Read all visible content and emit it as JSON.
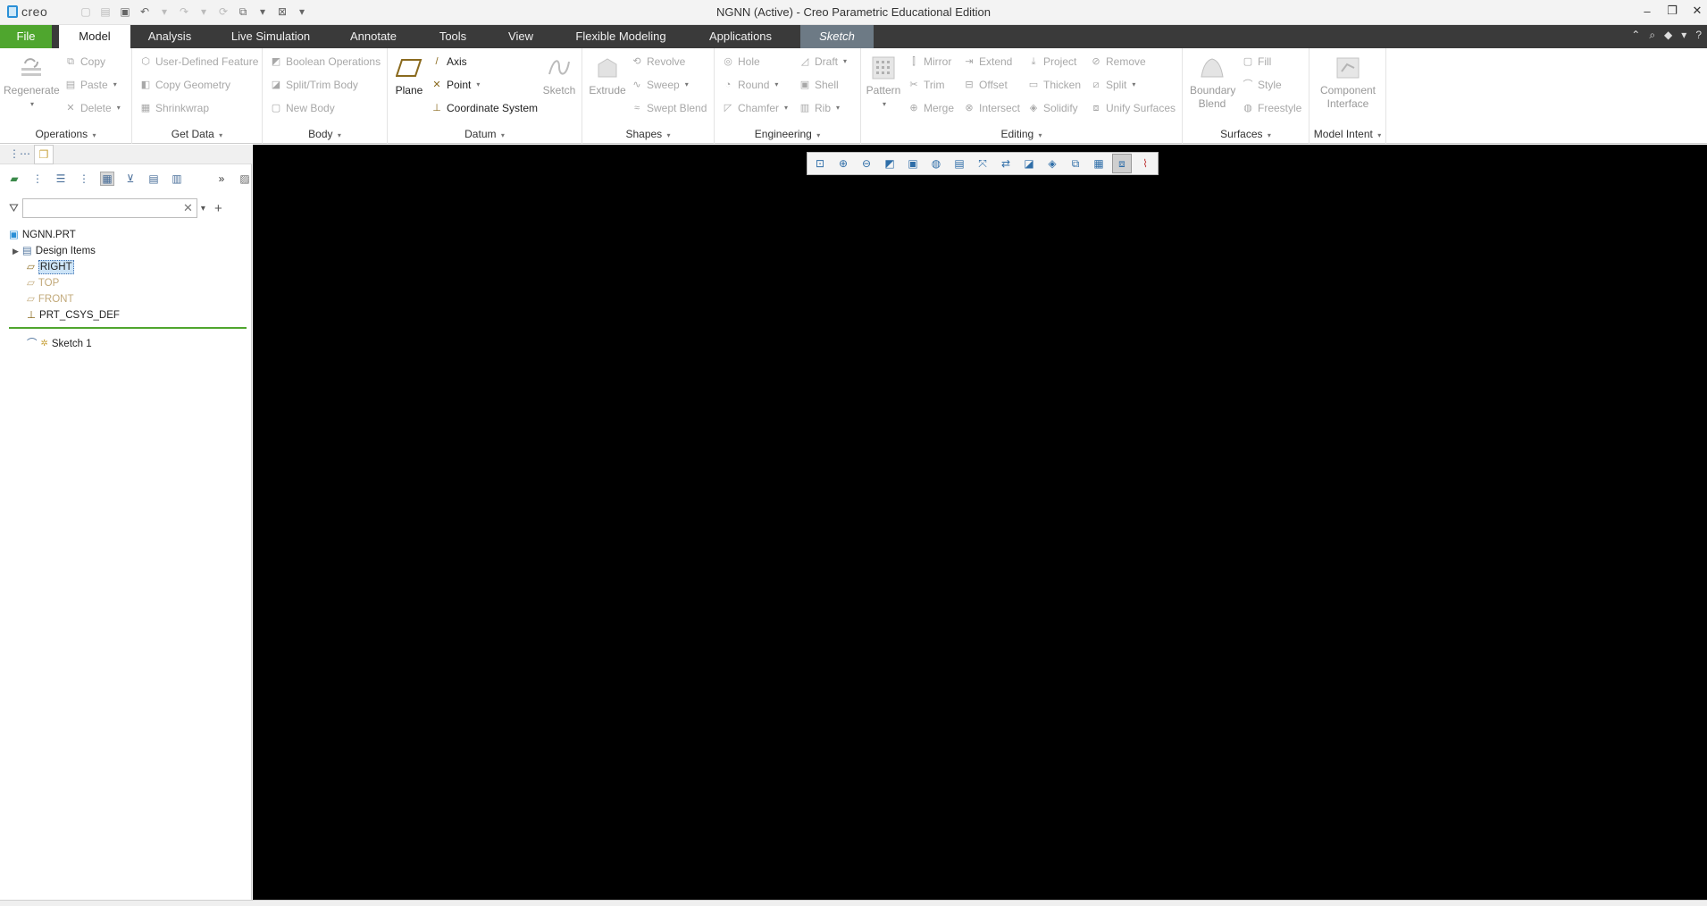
{
  "app": {
    "logo_text": "creo",
    "window_title": "NGNN (Active) - Creo Parametric Educational Edition"
  },
  "tabs": [
    {
      "label": "File"
    },
    {
      "label": "Model"
    },
    {
      "label": "Analysis"
    },
    {
      "label": "Live Simulation"
    },
    {
      "label": "Annotate"
    },
    {
      "label": "Tools"
    },
    {
      "label": "View"
    },
    {
      "label": "Flexible Modeling"
    },
    {
      "label": "Applications"
    },
    {
      "label": "Sketch"
    }
  ],
  "ribbon": {
    "operations": {
      "label": "Operations",
      "regenerate": "Regenerate",
      "copy": "Copy",
      "paste": "Paste",
      "delete": "Delete"
    },
    "get_data": {
      "label": "Get Data",
      "udf": "User-Defined Feature",
      "copy_geometry": "Copy Geometry",
      "shrinkwrap": "Shrinkwrap"
    },
    "body": {
      "label": "Body",
      "boolean": "Boolean Operations",
      "split_trim": "Split/Trim Body",
      "new_body": "New Body"
    },
    "datum": {
      "label": "Datum",
      "plane": "Plane",
      "axis": "Axis",
      "point": "Point",
      "csys": "Coordinate System",
      "sketch": "Sketch"
    },
    "shapes": {
      "label": "Shapes",
      "extrude": "Extrude",
      "revolve": "Revolve",
      "sweep": "Sweep",
      "swept_blend": "Swept Blend"
    },
    "engineering": {
      "label": "Engineering",
      "hole": "Hole",
      "round": "Round",
      "chamfer": "Chamfer",
      "draft": "Draft",
      "shell": "Shell",
      "rib": "Rib"
    },
    "editing": {
      "label": "Editing",
      "pattern": "Pattern",
      "mirror": "Mirror",
      "trim": "Trim",
      "merge": "Merge",
      "extend": "Extend",
      "offset": "Offset",
      "intersect": "Intersect",
      "project": "Project",
      "thicken": "Thicken",
      "solidify": "Solidify",
      "remove": "Remove",
      "split": "Split",
      "unify": "Unify Surfaces"
    },
    "surfaces": {
      "label": "Surfaces",
      "boundary_blend": "Boundary Blend",
      "fill": "Fill",
      "style": "Style",
      "freestyle": "Freestyle"
    },
    "model_intent": {
      "label": "Model Intent",
      "component_interface": "Component Interface"
    }
  },
  "tree": {
    "root": "NGNN.PRT",
    "items": [
      {
        "label": "Design Items"
      },
      {
        "label": "RIGHT"
      },
      {
        "label": "TOP"
      },
      {
        "label": "FRONT"
      },
      {
        "label": "PRT_CSYS_DEF"
      },
      {
        "label": "Sketch 1"
      }
    ]
  },
  "colors": {
    "file_tab": "#4fa62e",
    "tab_bar": "#3a3a3a",
    "sketch_tab": "#6d7a85",
    "graphics_bg": "#000000"
  }
}
